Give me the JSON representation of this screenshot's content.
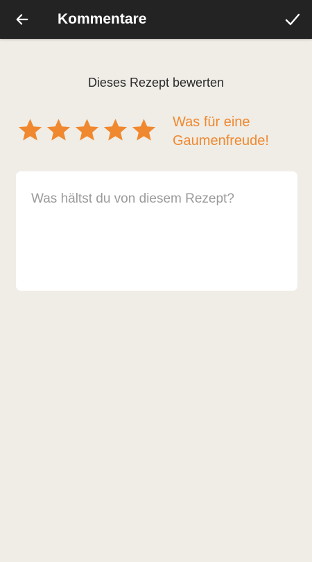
{
  "header": {
    "title": "Kommentare",
    "back_icon": "arrow-left-icon",
    "confirm_icon": "check-icon"
  },
  "rating": {
    "heading": "Dieses Rezept bewerten",
    "value": 5,
    "max": 5,
    "label": "Was für eine Gaumenfreude!",
    "star_color": "#f0882f"
  },
  "comment": {
    "placeholder": "Was hältst du von diesem Rezept?",
    "value": ""
  },
  "colors": {
    "toolbar": "#232323",
    "background": "#efede6",
    "accent": "#f0882f"
  }
}
